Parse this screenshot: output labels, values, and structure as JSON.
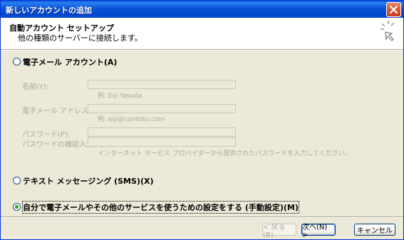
{
  "window": {
    "title": "新しいアカウントの追加"
  },
  "header": {
    "title": "自動アカウント セットアップ",
    "subtitle": "他の種類のサーバーに接続します。"
  },
  "options": {
    "email_account": "電子メール アカウント(A)",
    "sms": "テキスト メッセージング (SMS)(X)",
    "manual": "自分で電子メールやその他のサービスを使うための設定をする (手動設定)(M)"
  },
  "form": {
    "name_label": "名前(Y):",
    "name_hint": "例: Eiji Yasuda",
    "email_label": "電子メール アドレス(E):",
    "email_hint": "例: eiji@contoso.com",
    "password_label": "パスワード(P):",
    "password_confirm_label": "パスワードの確認入力(T):",
    "password_hint": "インターネット サービス プロバイダーから提供されたパスワードを入力してください。",
    "name_value": "",
    "email_value": "",
    "password_value": "",
    "password_confirm_value": ""
  },
  "buttons": {
    "back": "< 戻る(B)",
    "next": "次へ(N) >",
    "cancel": "キャンセル"
  },
  "selected_option": "manual",
  "colors": {
    "titlebar": "#0a54d6",
    "dialog_bg": "#ece9d8",
    "disabled_text": "#aca899"
  }
}
